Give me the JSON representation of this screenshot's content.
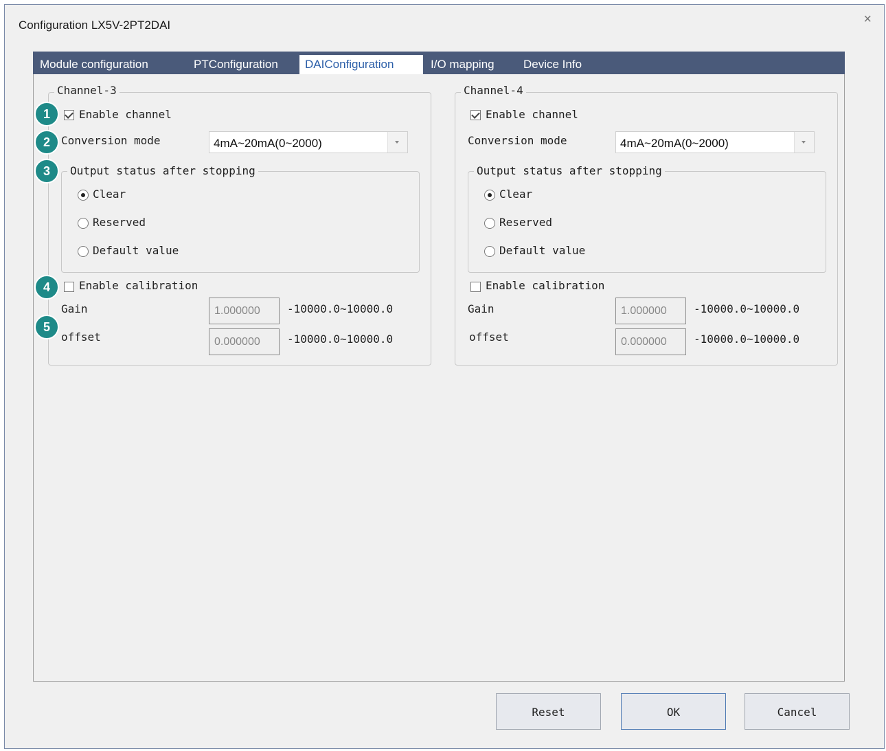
{
  "window": {
    "title": "Configuration LX5V-2PT2DAI",
    "close_glyph": "×"
  },
  "tabs": [
    {
      "label": "Module configuration",
      "active": false
    },
    {
      "label": "PTConfiguration",
      "active": false
    },
    {
      "label": "DAIConfiguration",
      "active": true
    },
    {
      "label": "I/O mapping",
      "active": false
    },
    {
      "label": "Device Info",
      "active": false
    }
  ],
  "channels": [
    {
      "title": "Channel-3",
      "enable_label": "Enable channel",
      "enable_checked": true,
      "conversion_label": "Conversion mode",
      "conversion_value": "4mA~20mA(0~2000)",
      "output_group_label": "Output status after stopping",
      "output_options": [
        {
          "label": "Clear",
          "selected": true
        },
        {
          "label": "Reserved",
          "selected": false
        },
        {
          "label": "Default value",
          "selected": false
        }
      ],
      "calibration_label": "Enable calibration",
      "calibration_checked": false,
      "gain_label": "Gain",
      "gain_value": "1.000000",
      "gain_range": "-10000.0~10000.0",
      "offset_label": "offset",
      "offset_value": "0.000000",
      "offset_range": "-10000.0~10000.0"
    },
    {
      "title": "Channel-4",
      "enable_label": "Enable channel",
      "enable_checked": true,
      "conversion_label": "Conversion mode",
      "conversion_value": "4mA~20mA(0~2000)",
      "output_group_label": "Output status after stopping",
      "output_options": [
        {
          "label": "Clear",
          "selected": true
        },
        {
          "label": "Reserved",
          "selected": false
        },
        {
          "label": "Default value",
          "selected": false
        }
      ],
      "calibration_label": "Enable calibration",
      "calibration_checked": false,
      "gain_label": "Gain",
      "gain_value": "1.000000",
      "gain_range": "-10000.0~10000.0",
      "offset_label": "offset",
      "offset_value": "0.000000",
      "offset_range": "-10000.0~10000.0"
    }
  ],
  "badges": [
    "1",
    "2",
    "3",
    "4",
    "5"
  ],
  "buttons": {
    "reset": "Reset",
    "ok": "OK",
    "cancel": "Cancel"
  },
  "colors": {
    "tab_bar": "#4a5a7a",
    "active_tab_text": "#2b5ea8",
    "badge": "#1e8a88"
  }
}
